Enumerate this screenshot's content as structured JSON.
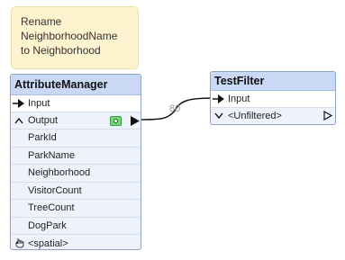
{
  "annotation": {
    "lines": [
      "Rename",
      "NeighborhoodName",
      "to Neighborhood"
    ]
  },
  "attribute_manager": {
    "title": "AttributeManager",
    "input_port": "Input",
    "output_port": "Output",
    "attributes": [
      "ParkId",
      "ParkName",
      "Neighborhood",
      "VisitorCount",
      "TreeCount",
      "DogPark"
    ],
    "spatial": "<spatial>"
  },
  "connection": {
    "feature_count": "80"
  },
  "test_filter": {
    "title": "TestFilter",
    "input_port": "Input",
    "unfiltered_port": "<Unfiltered>"
  },
  "colors": {
    "node_header": "#c9d9f5",
    "node_body": "#eef3fb",
    "node_border": "#8fa3c4",
    "annotation_bg": "#fdf3cf",
    "lineage_icon": "#79d27f"
  }
}
